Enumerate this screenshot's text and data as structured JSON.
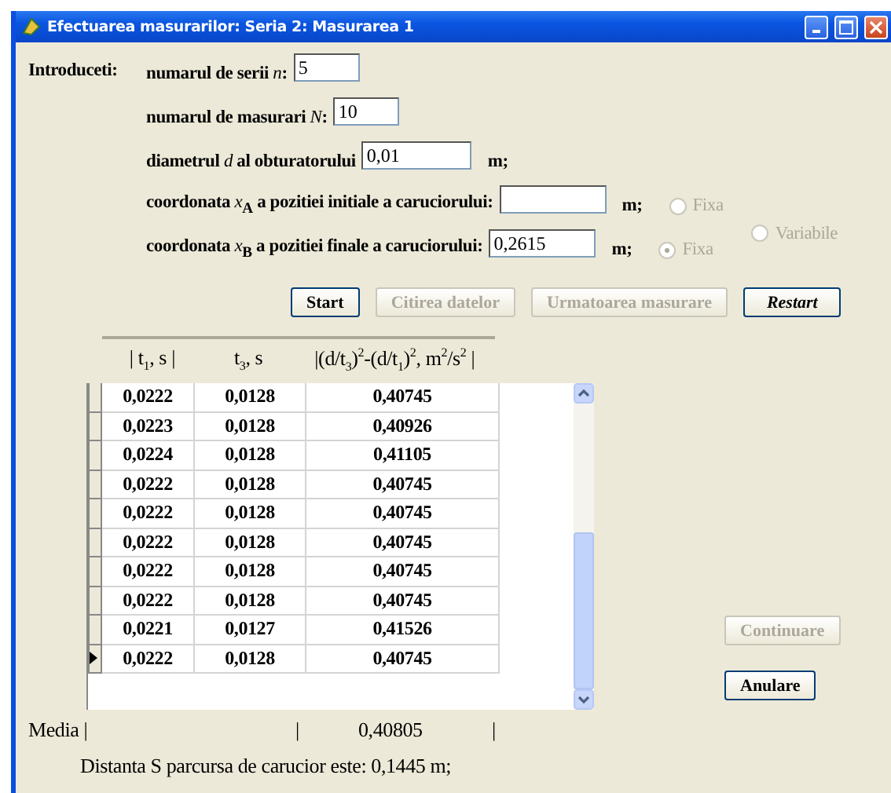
{
  "window": {
    "title": "Efectuarea masurarilor: Seria 2: Masurarea 1"
  },
  "intro_label": "Introduceti:",
  "fields": [
    {
      "label": "numarul de serii  *n*:",
      "value": "5",
      "kind": "short"
    },
    {
      "label": "numarul de masurari  *N*:",
      "value": "10",
      "kind": "short"
    },
    {
      "label": "diametrul *d* al obturatorului",
      "value": "0,01",
      "unit": "m;",
      "kind": "long"
    }
  ],
  "position_fields": [
    {
      "label": "coordonata *x*$_{A}$ a pozitiei initiale a caruciorului:",
      "unit": "m;",
      "radio": {
        "label": "Fixa",
        "selected": false,
        "disabled": true
      }
    },
    {
      "label": "coordonata *x*$_{B}$ a pozitiei finale a caruciorului:",
      "value": "0,2615",
      "unit": "m;",
      "radio": {
        "label": "Fixa",
        "selected": true,
        "disabled": true
      }
    }
  ],
  "variable_radio": {
    "label": "Variabile",
    "selected": false,
    "disabled": true
  },
  "buttons": [
    {
      "label": "Start",
      "disabled": false,
      "kind": "plain"
    },
    {
      "label": "Citirea datelor",
      "disabled": true,
      "kind": "plain"
    },
    {
      "label": "Urmatoarea masurare",
      "disabled": true,
      "kind": "plain"
    },
    {
      "label": "Restart",
      "disabled": false,
      "kind": "emphasis"
    }
  ],
  "table": {
    "headers": [
      "| t$_{1}$,  s  |",
      "t$_{3}$,  s",
      "|(d/t$_{3}$)$^{2}$-(d/t$_{1}$)$^{2}$,  m$^{2}$/s$^{2}$ |"
    ],
    "rows": [
      {
        "cells": [
          "0,0222",
          "0,0128",
          "0,40745"
        ],
        "selected": false
      },
      {
        "cells": [
          "0,0223",
          "0,0128",
          "0,40926"
        ],
        "selected": false
      },
      {
        "cells": [
          "0,0224",
          "0,0128",
          "0,41105"
        ],
        "selected": false
      },
      {
        "cells": [
          "0,0222",
          "0,0128",
          "0,40745"
        ],
        "selected": false
      },
      {
        "cells": [
          "0,0222",
          "0,0128",
          "0,40745"
        ],
        "selected": false
      },
      {
        "cells": [
          "0,0222",
          "0,0128",
          "0,40745"
        ],
        "selected": false
      },
      {
        "cells": [
          "0,0222",
          "0,0128",
          "0,40745"
        ],
        "selected": false
      },
      {
        "cells": [
          "0,0222",
          "0,0128",
          "0,40745"
        ],
        "selected": false
      },
      {
        "cells": [
          "0,0221",
          "0,0127",
          "0,41526"
        ],
        "selected": false
      },
      {
        "cells": [
          "0,0222",
          "0,0128",
          "0,40745"
        ],
        "selected": true
      }
    ]
  },
  "side_buttons": [
    {
      "label": "Continuare",
      "disabled": true
    },
    {
      "label": "Anulare",
      "disabled": false
    }
  ],
  "media": {
    "label": "Media |",
    "separator_1": "|",
    "value": "0,40805",
    "separator_2": "|"
  },
  "result": "Distanta S parcursa de carucior este: 0,1445 m;"
}
